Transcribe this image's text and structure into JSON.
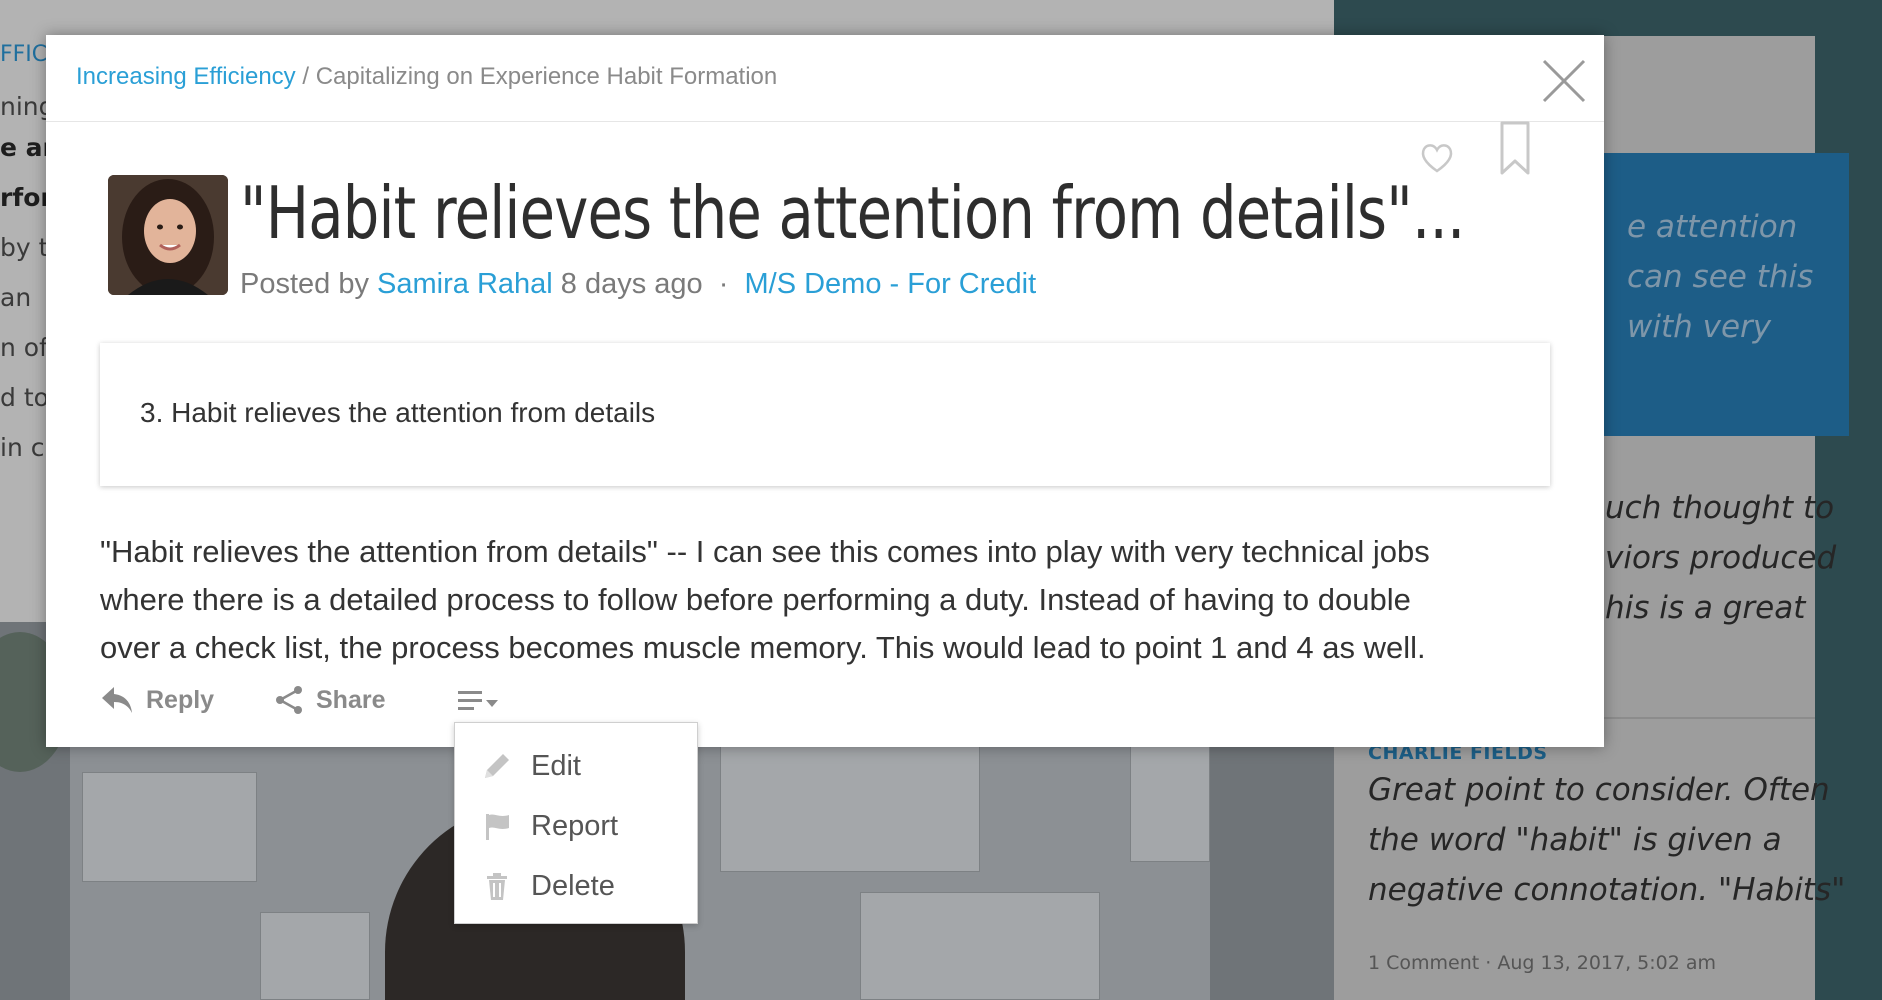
{
  "background": {
    "left_fragments": [
      "FFICI",
      "ning",
      "e are",
      "rfor",
      "by t",
      "an",
      "n of",
      "d to",
      "in c"
    ],
    "right_quote_lines": [
      "e attention",
      "can see this",
      "with very"
    ],
    "right_comment_lines": [
      "uch thought to",
      "viors produced",
      "his is a great"
    ],
    "comment": {
      "author": "CHARLIE FIELDS",
      "lines": [
        "Great point to consider. Often",
        "the word \"habit\" is given a",
        "negative connotation. \"Habits\""
      ],
      "meta": "1 Comment · Aug 13, 2017, 5:02 am"
    }
  },
  "modal": {
    "breadcrumb": {
      "parent": "Increasing Efficiency",
      "separator": " / ",
      "current": "Capitalizing on Experience Habit Formation"
    },
    "title": "\"Habit relieves the attention from details\"...",
    "meta": {
      "posted_by": "Posted by",
      "author": "Samira Rahal",
      "time": "8 days ago",
      "separator": "·",
      "group": "M/S Demo - For Credit"
    },
    "quote": "3. Habit relieves the attention from details",
    "body_lines": [
      "\"Habit relieves the attention from details\" -- I can see this comes into play with very technical jobs",
      "where there is a detailed process to follow before performing a duty. Instead of having to double",
      "over a check list, the process becomes muscle memory.  This would lead to point 1 and 4 as well."
    ],
    "actions": {
      "reply": "Reply",
      "share": "Share"
    }
  },
  "dropdown": {
    "items": [
      {
        "label": "Edit",
        "icon": "pencil-icon"
      },
      {
        "label": "Report",
        "icon": "flag-icon"
      },
      {
        "label": "Delete",
        "icon": "trash-icon"
      }
    ]
  },
  "colors": {
    "link": "#2a9fd6",
    "overlay_quote_box": "#1d5d87",
    "muted_text": "#8a8a8a"
  }
}
